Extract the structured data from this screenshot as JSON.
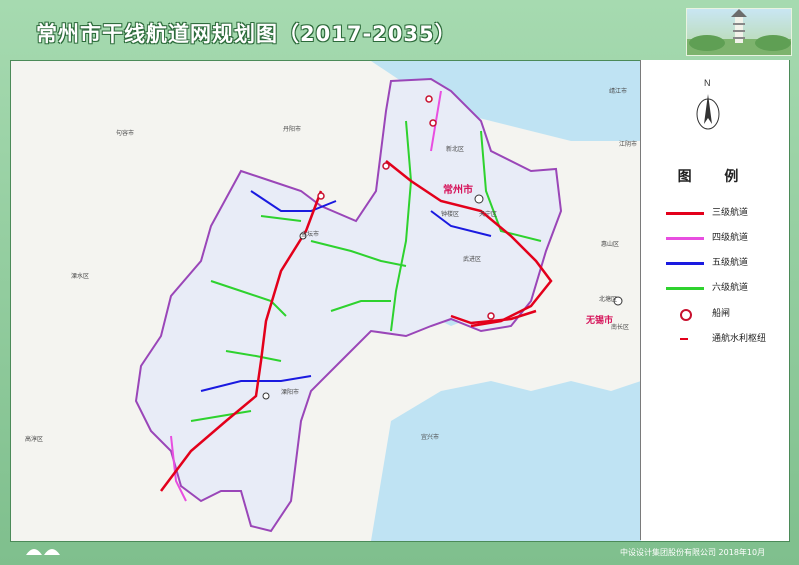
{
  "title": "常州市干线航道网规划图（2017-2035）",
  "legend": {
    "title": "图 例",
    "items": [
      {
        "label": "三级航道",
        "color": "#e3001b",
        "kind": "line"
      },
      {
        "label": "四级航道",
        "color": "#e84ee0",
        "kind": "line"
      },
      {
        "label": "五级航道",
        "color": "#1a1ae0",
        "kind": "line"
      },
      {
        "label": "六级航道",
        "color": "#2ed22e",
        "kind": "line"
      },
      {
        "label": "船闸",
        "color": "#c8102e",
        "kind": "lock"
      },
      {
        "label": "通航水利枢纽",
        "color": "#e3001b",
        "kind": "hub"
      }
    ]
  },
  "north_label": "N",
  "map_labels": {
    "changzhou": "常州市",
    "wuxi": "无锡市",
    "tianning": "天宁区",
    "zhonglou": "钟楼区",
    "wujin": "武进区",
    "xinbei": "新北区",
    "jintan": "金坛市",
    "liyang": "溧阳市",
    "danyang": "丹阳市",
    "jurong": "句容市",
    "lishui": "溧水区",
    "gaochun": "高淳区",
    "yixing": "宜兴市",
    "jiangyin": "江阴市",
    "jingjiang": "靖江市",
    "beitang": "北塘区",
    "nanchang": "南长区",
    "huishan": "惠山区"
  },
  "footer": {
    "org": "中设设计集团股份有限公司",
    "date": "2018年10月"
  }
}
